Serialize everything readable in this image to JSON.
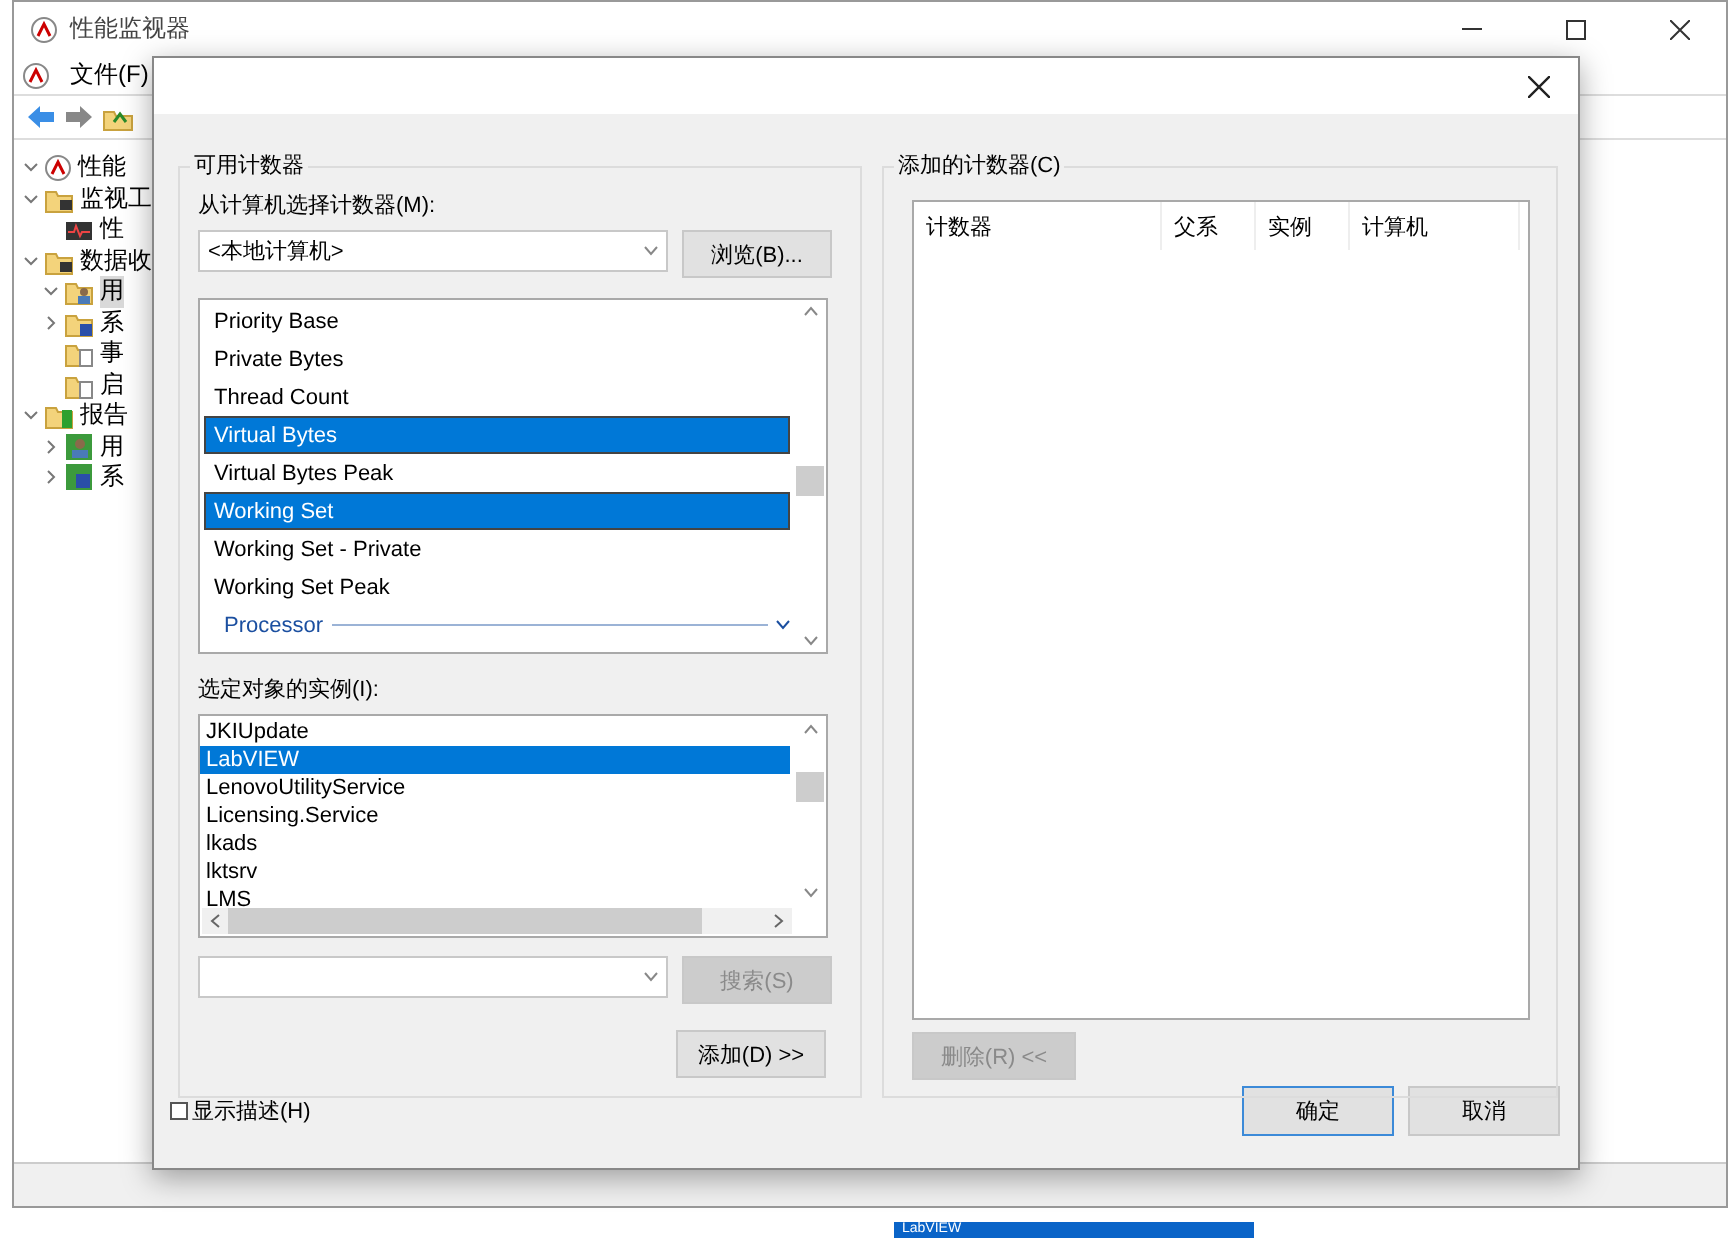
{
  "window": {
    "title": "性能监视器",
    "menu": [
      "文件(F)"
    ]
  },
  "tree": [
    {
      "label": "性能",
      "expanded": true
    },
    {
      "label": "监视工",
      "expanded": true,
      "children": [
        {
          "label": "性"
        }
      ]
    },
    {
      "label": "数据收",
      "expanded": true,
      "children": [
        {
          "label": "用",
          "selected": true,
          "expanded": true
        },
        {
          "label": "系",
          "selected": false,
          "expanded": false
        },
        {
          "label": "事",
          "selected": false
        },
        {
          "label": "启",
          "selected": false
        }
      ]
    },
    {
      "label": "报告",
      "expanded": true,
      "children": [
        {
          "label": "用",
          "selected": false,
          "expanded": false
        },
        {
          "label": "系",
          "selected": false,
          "expanded": false
        }
      ]
    }
  ],
  "taskbar_item": "LabVIEW",
  "dialog": {
    "available": {
      "title": "可用计数器",
      "computer_label": "从计算机选择计数器(M):",
      "computer_value": "<本地计算机>",
      "browse_button": "浏览(B)...",
      "counters": [
        {
          "label": "Priority Base",
          "kind": "counter",
          "selected": false
        },
        {
          "label": "Private Bytes",
          "kind": "counter",
          "selected": false
        },
        {
          "label": "Thread Count",
          "kind": "counter",
          "selected": false
        },
        {
          "label": "Virtual Bytes",
          "kind": "counter",
          "selected": true
        },
        {
          "label": "Virtual Bytes Peak",
          "kind": "counter",
          "selected": false
        },
        {
          "label": "Working Set",
          "kind": "counter",
          "selected": true
        },
        {
          "label": "Working Set - Private",
          "kind": "counter",
          "selected": false
        },
        {
          "label": "Working Set Peak",
          "kind": "counter",
          "selected": false
        },
        {
          "label": "Processor",
          "kind": "category",
          "selected": false
        }
      ],
      "instances_label": "选定对象的实例(I):",
      "instances": [
        {
          "label": "JKIUpdate",
          "selected": false
        },
        {
          "label": "LabVIEW",
          "selected": true
        },
        {
          "label": "LenovoUtilityService",
          "selected": false
        },
        {
          "label": "Licensing.Service",
          "selected": false
        },
        {
          "label": "lkads",
          "selected": false
        },
        {
          "label": "lktsrv",
          "selected": false
        },
        {
          "label": "LMS",
          "selected": false
        }
      ],
      "search_button": {
        "label": "搜索(S)",
        "disabled": true
      },
      "add_button": {
        "label": "添加(D) >>",
        "disabled": false
      }
    },
    "added": {
      "title": "添加的计数器(C)",
      "columns": [
        "计数器",
        "父系",
        "实例",
        "计算机"
      ],
      "remove_button": {
        "label": "删除(R) <<",
        "disabled": true
      }
    },
    "show_description": {
      "label": "显示描述(H)",
      "checked": false
    },
    "ok_button": "确定",
    "cancel_button": "取消"
  }
}
